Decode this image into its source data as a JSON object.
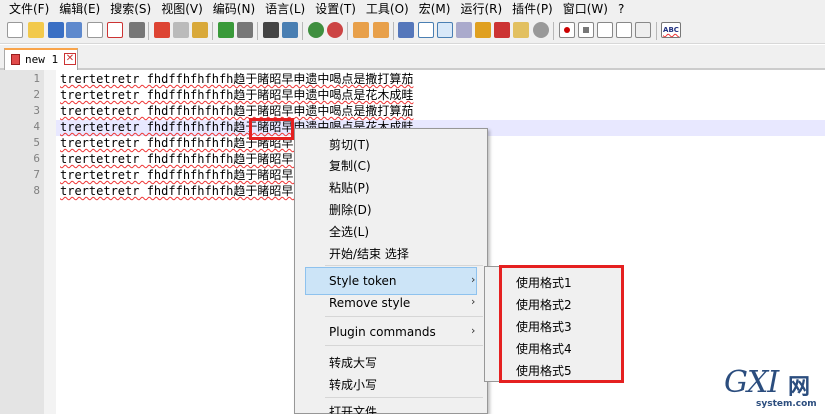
{
  "menubar": {
    "items": [
      "文件(F)",
      "编辑(E)",
      "搜索(S)",
      "视图(V)",
      "编码(N)",
      "语言(L)",
      "设置(T)",
      "工具(O)",
      "宏(M)",
      "运行(R)",
      "插件(P)",
      "窗口(W)",
      "?"
    ]
  },
  "toolbar": {
    "spellcheck_label": "ABC"
  },
  "tab": {
    "label": "new 1",
    "close_glyph": "✕"
  },
  "editor": {
    "lines": [
      {
        "num": "1",
        "text": "trertetretr fhdffhfhfhfh趋于睹昭早申遗中喝点是撒打算茄"
      },
      {
        "num": "2",
        "text": "trertetretr fhdffhfhfhfh趋于睹昭早申遗中喝点是花木成畦"
      },
      {
        "num": "3",
        "text": "trertetretr fhdffhfhfhfh趋于睹昭早申遗中喝点是撒打算茄"
      },
      {
        "num": "4",
        "text": "trertetretr fhdffhfhfhfh趋于睹昭早申遗中喝点是花木成畦"
      },
      {
        "num": "5",
        "text": "trertetretr fhdffhfhfhfh趋于睹昭早申遗中喝点是撒打算茄"
      },
      {
        "num": "6",
        "text": "trertetretr fhdffhfhfhfh趋于睹昭早申遗中喝点是花木成畦"
      },
      {
        "num": "7",
        "text": "trertetretr fhdffhfhfhfh趋于睹昭早申遗中喝点是撒打算茄"
      },
      {
        "num": "8",
        "text": "trertetretr fhdffhfhfhfh趋于睹昭早申遗中喝点是花木成畦"
      }
    ]
  },
  "context_menu": {
    "cut": "剪切(T)",
    "copy": "复制(C)",
    "paste": "粘贴(P)",
    "delete": "删除(D)",
    "select_all": "全选(L)",
    "begin_end_select": "开始/结束 选择",
    "style_token": "Style token",
    "remove_style": "Remove style",
    "plugin_commands": "Plugin commands",
    "uppercase": "转成大写",
    "lowercase": "转成小写",
    "open_file": "打开文件",
    "arrow_glyph": "›"
  },
  "style_submenu": {
    "items": [
      "使用格式1",
      "使用格式2",
      "使用格式3",
      "使用格式4",
      "使用格式5"
    ]
  },
  "watermark": {
    "brand": "GXI",
    "brand_cn": "网",
    "site": "system.com"
  },
  "colors": {
    "highlight_box": "#e52020",
    "menu_hover": "#cce4f7",
    "current_line": "#e8e8ff",
    "tab_accent": "#f9a44a"
  }
}
